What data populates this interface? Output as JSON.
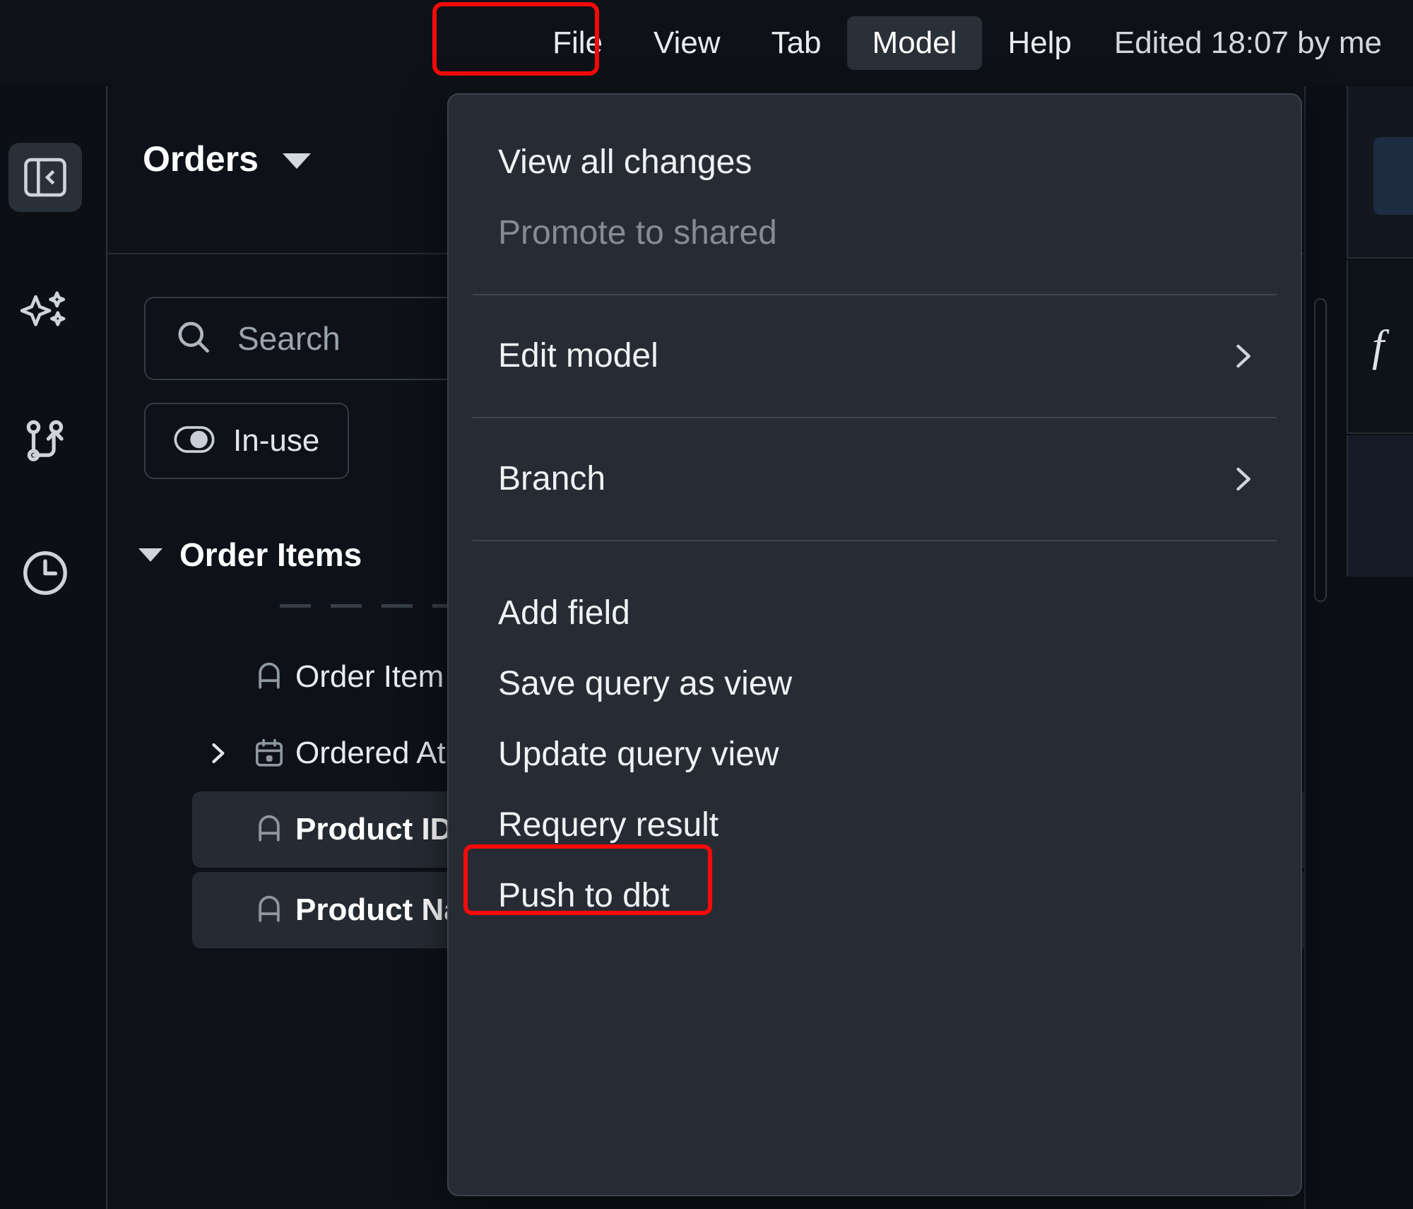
{
  "menubar": {
    "items": [
      {
        "label": "File",
        "active": false
      },
      {
        "label": "View",
        "active": false
      },
      {
        "label": "Tab",
        "active": false
      },
      {
        "label": "Model",
        "active": true
      },
      {
        "label": "Help",
        "active": false
      }
    ],
    "status": "Edited 18:07 by me",
    "highlight_color": "#f50a0a"
  },
  "rail": {
    "items": [
      {
        "name": "collapse-panel-icon",
        "selected": true
      },
      {
        "name": "ai-sparkle-icon",
        "selected": false
      },
      {
        "name": "branch-icon",
        "selected": false
      },
      {
        "name": "history-clock-icon",
        "selected": false
      }
    ]
  },
  "panel": {
    "title": "Orders",
    "search": {
      "placeholder": "Search",
      "value": ""
    },
    "filter_pill": {
      "label": "In-use"
    }
  },
  "tree": {
    "group": {
      "label": "Order Items",
      "expanded": true
    },
    "fields": [
      {
        "name": "Order Item",
        "type_icon": "text-type-icon",
        "expandable": false,
        "selected": false
      },
      {
        "name": "Ordered At",
        "type_icon": "calendar-type-icon",
        "expandable": true,
        "selected": false
      },
      {
        "name": "Product ID",
        "type_icon": "text-type-icon",
        "expandable": false,
        "selected": true
      },
      {
        "name": "Product Name",
        "type_icon": "text-type-icon",
        "expandable": false,
        "selected": true
      }
    ]
  },
  "right_strip": {
    "formula_symbol": "f"
  },
  "dropdown": {
    "sections": [
      {
        "items": [
          {
            "label": "View all changes",
            "disabled": false,
            "submenu": false,
            "highlighted": false
          },
          {
            "label": "Promote to shared",
            "disabled": true,
            "submenu": false,
            "highlighted": false
          }
        ]
      },
      {
        "items": [
          {
            "label": "Edit model",
            "disabled": false,
            "submenu": true,
            "highlighted": false
          }
        ]
      },
      {
        "items": [
          {
            "label": "Branch",
            "disabled": false,
            "submenu": true,
            "highlighted": false
          }
        ]
      },
      {
        "items": [
          {
            "label": "Add field",
            "disabled": false,
            "submenu": false,
            "highlighted": false
          },
          {
            "label": "Save query as view",
            "disabled": false,
            "submenu": false,
            "highlighted": false
          },
          {
            "label": "Update query view",
            "disabled": false,
            "submenu": false,
            "highlighted": false
          },
          {
            "label": "Requery result",
            "disabled": false,
            "submenu": false,
            "highlighted": false
          },
          {
            "label": "Push to dbt",
            "disabled": false,
            "submenu": false,
            "highlighted": true
          }
        ]
      }
    ]
  }
}
